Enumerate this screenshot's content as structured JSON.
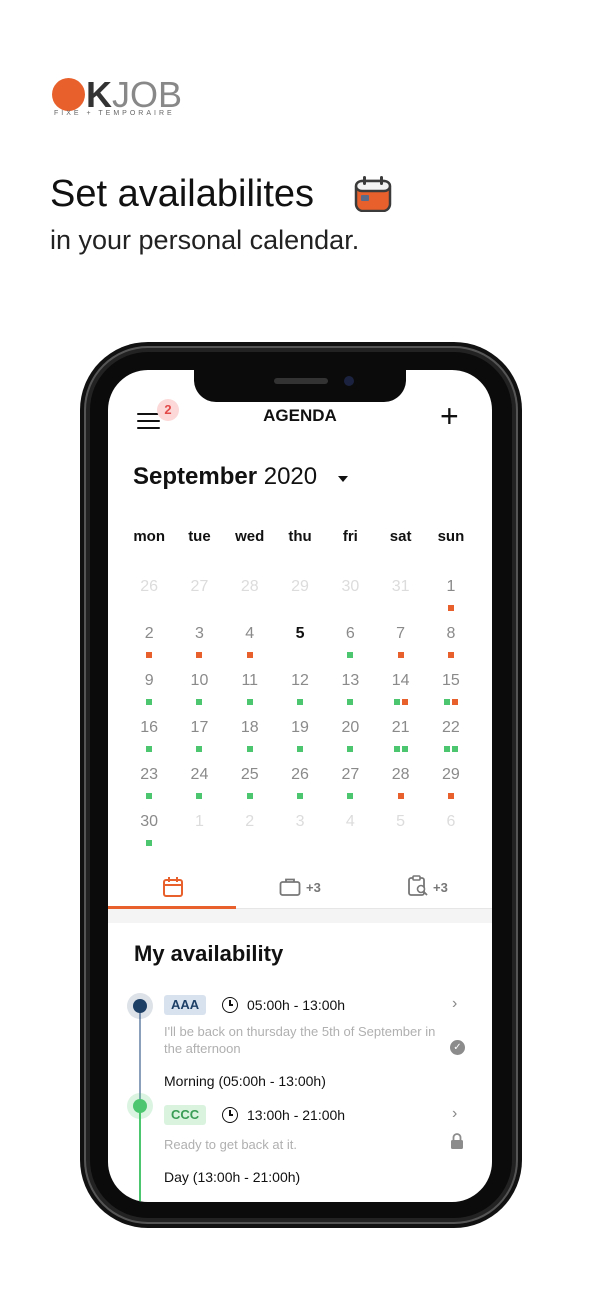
{
  "brand": {
    "logo_letters": "OKJOB",
    "logo_k": "K",
    "logo_job": "JOB",
    "tagline": "FIXE + TEMPORAIRE",
    "accent": "#e8612c"
  },
  "headline": "Set availabilites",
  "subline": "in your personal calendar.",
  "headline_icon": "calendar-emoji-icon",
  "app": {
    "title": "AGENDA",
    "notifications_badge": "2",
    "menu_icon": "hamburger-icon",
    "add_icon": "plus-icon",
    "month_name": "September",
    "year": "2020",
    "weekdays": [
      "mon",
      "tue",
      "wed",
      "thu",
      "fri",
      "sat",
      "sun"
    ],
    "weeks": [
      [
        {
          "d": "26",
          "f": true,
          "dots": []
        },
        {
          "d": "27",
          "f": true,
          "dots": []
        },
        {
          "d": "28",
          "f": true,
          "dots": []
        },
        {
          "d": "29",
          "f": true,
          "dots": []
        },
        {
          "d": "30",
          "f": true,
          "dots": []
        },
        {
          "d": "31",
          "f": true,
          "dots": []
        },
        {
          "d": "1",
          "f": false,
          "dots": [
            "o"
          ]
        }
      ],
      [
        {
          "d": "2",
          "f": false,
          "dots": [
            "o"
          ]
        },
        {
          "d": "3",
          "f": false,
          "dots": [
            "o"
          ]
        },
        {
          "d": "4",
          "f": false,
          "dots": [
            "o"
          ]
        },
        {
          "d": "5",
          "f": false,
          "today": true,
          "dots": []
        },
        {
          "d": "6",
          "f": false,
          "dots": [
            "g"
          ]
        },
        {
          "d": "7",
          "f": false,
          "dots": [
            "o"
          ]
        },
        {
          "d": "8",
          "f": false,
          "dots": [
            "o"
          ]
        }
      ],
      [
        {
          "d": "9",
          "f": false,
          "dots": [
            "g"
          ]
        },
        {
          "d": "10",
          "f": false,
          "dots": [
            "g"
          ]
        },
        {
          "d": "11",
          "f": false,
          "dots": [
            "g"
          ]
        },
        {
          "d": "12",
          "f": false,
          "dots": [
            "g"
          ]
        },
        {
          "d": "13",
          "f": false,
          "dots": [
            "g"
          ]
        },
        {
          "d": "14",
          "f": false,
          "dots": [
            "g",
            "o"
          ]
        },
        {
          "d": "15",
          "f": false,
          "dots": [
            "g",
            "o"
          ]
        }
      ],
      [
        {
          "d": "16",
          "f": false,
          "dots": [
            "g"
          ]
        },
        {
          "d": "17",
          "f": false,
          "dots": [
            "g"
          ]
        },
        {
          "d": "18",
          "f": false,
          "dots": [
            "g"
          ]
        },
        {
          "d": "19",
          "f": false,
          "dots": [
            "g"
          ]
        },
        {
          "d": "20",
          "f": false,
          "dots": [
            "g"
          ]
        },
        {
          "d": "21",
          "f": false,
          "dots": [
            "g",
            "g"
          ]
        },
        {
          "d": "22",
          "f": false,
          "dots": [
            "g",
            "g"
          ]
        }
      ],
      [
        {
          "d": "23",
          "f": false,
          "dots": [
            "g"
          ]
        },
        {
          "d": "24",
          "f": false,
          "dots": [
            "g"
          ]
        },
        {
          "d": "25",
          "f": false,
          "dots": [
            "g"
          ]
        },
        {
          "d": "26",
          "f": false,
          "dots": [
            "g"
          ]
        },
        {
          "d": "27",
          "f": false,
          "dots": [
            "g"
          ]
        },
        {
          "d": "28",
          "f": false,
          "dots": [
            "o"
          ]
        },
        {
          "d": "29",
          "f": false,
          "dots": [
            "o"
          ]
        }
      ],
      [
        {
          "d": "30",
          "f": false,
          "dots": [
            "g"
          ]
        },
        {
          "d": "1",
          "f": true,
          "dots": []
        },
        {
          "d": "2",
          "f": true,
          "dots": []
        },
        {
          "d": "3",
          "f": true,
          "dots": []
        },
        {
          "d": "4",
          "f": true,
          "dots": []
        },
        {
          "d": "5",
          "f": true,
          "dots": []
        },
        {
          "d": "6",
          "f": true,
          "dots": []
        }
      ]
    ],
    "tabs": [
      {
        "icon": "calendar-icon",
        "count": ""
      },
      {
        "icon": "briefcase-icon",
        "count": "+3"
      },
      {
        "icon": "clipboard-search-icon",
        "count": "+3"
      }
    ],
    "availability_title": "My availability",
    "entries": [
      {
        "tag": "AAA",
        "time": "05:00h - 13:00h",
        "note": "I'll be back on thursday the 5th of September in the afternoon",
        "status_icon": "check-circle-icon",
        "period": "Morning (05:00h - 13:00h)",
        "color": "#1d3f66"
      },
      {
        "tag": "CCC",
        "time": "13:00h - 21:00h",
        "note": "Ready to get back at it.",
        "status_icon": "lock-icon",
        "period": "Day (13:00h - 21:00h)",
        "color": "#4cc76f"
      }
    ]
  }
}
